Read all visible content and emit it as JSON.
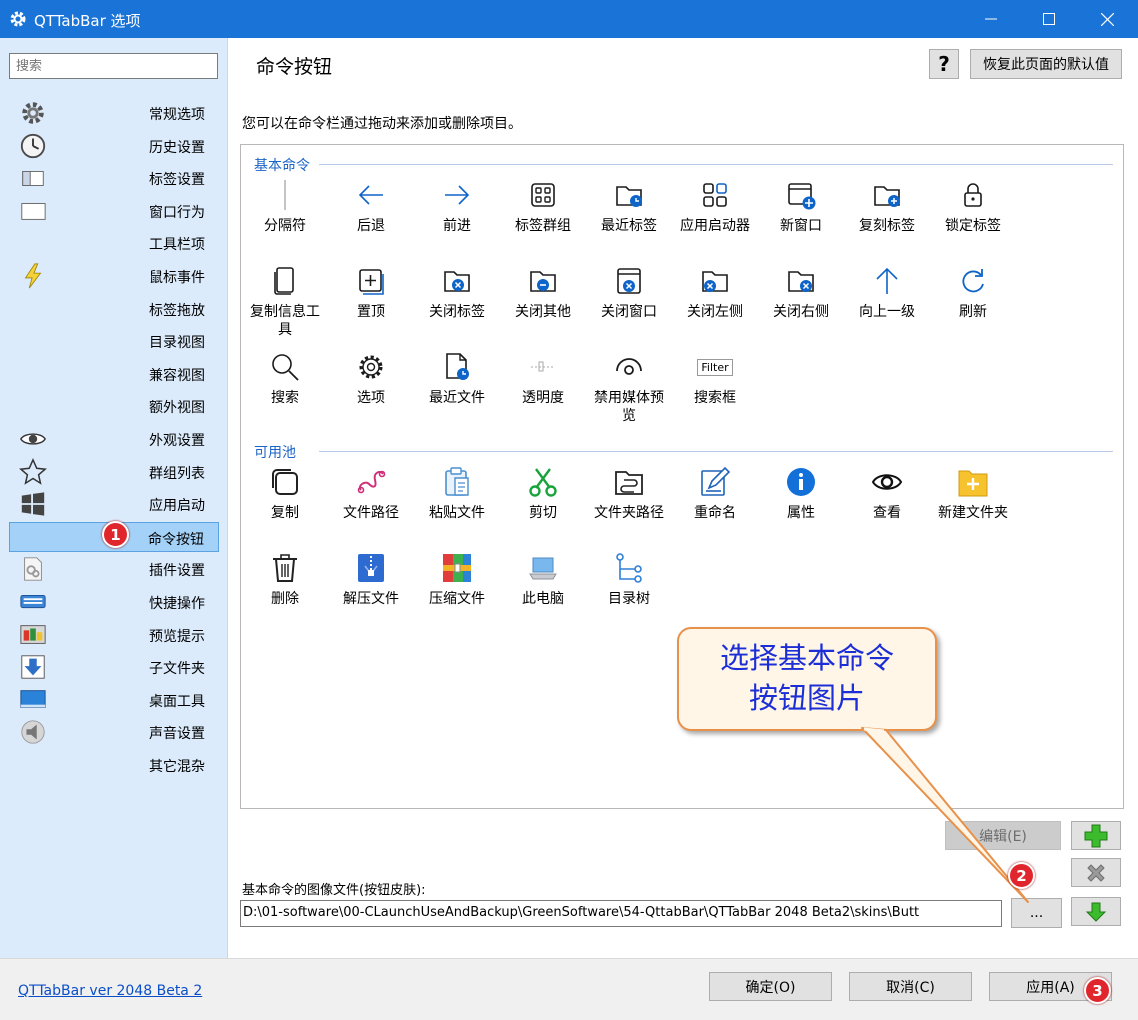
{
  "window": {
    "title": "QTTabBar 选项"
  },
  "sidebar": {
    "search_placeholder": "搜索",
    "items": [
      {
        "label": "常规选项",
        "icon": "gear-icon"
      },
      {
        "label": "历史设置",
        "icon": "clock-icon"
      },
      {
        "label": "标签设置",
        "icon": "tabs-icon"
      },
      {
        "label": "窗口行为",
        "icon": "window-icon"
      },
      {
        "label": "工具栏项",
        "icon": ""
      },
      {
        "label": "鼠标事件",
        "icon": "lightning-icon"
      },
      {
        "label": "标签拖放",
        "icon": ""
      },
      {
        "label": "目录视图",
        "icon": ""
      },
      {
        "label": "兼容视图",
        "icon": ""
      },
      {
        "label": "额外视图",
        "icon": ""
      },
      {
        "label": "外观设置",
        "icon": "eye-icon"
      },
      {
        "label": "群组列表",
        "icon": "star-icon"
      },
      {
        "label": "应用启动",
        "icon": "windows-logo-icon"
      },
      {
        "label": "命令按钮",
        "icon": "",
        "selected": true
      },
      {
        "label": "插件设置",
        "icon": "plugin-icon"
      },
      {
        "label": "快捷操作",
        "icon": "keyboard-icon"
      },
      {
        "label": "预览提示",
        "icon": "preview-icon"
      },
      {
        "label": "子文件夹",
        "icon": "download-arrow-icon"
      },
      {
        "label": "桌面工具",
        "icon": "desktop-icon"
      },
      {
        "label": "声音设置",
        "icon": "speaker-icon"
      },
      {
        "label": "其它混杂",
        "icon": ""
      }
    ]
  },
  "main": {
    "title": "命令按钮",
    "help_label": "?",
    "reset_label": "恢复此页面的默认值",
    "description": "您可以在命令栏通过拖动来添加或删除项目。",
    "basic_group_label": "基本命令",
    "pool_group_label": "可用池",
    "basic_commands": [
      {
        "label": "分隔符",
        "icon": "separator-icon"
      },
      {
        "label": "后退",
        "icon": "back-arrow-icon"
      },
      {
        "label": "前进",
        "icon": "forward-arrow-icon"
      },
      {
        "label": "标签群组",
        "icon": "tab-group-icon"
      },
      {
        "label": "最近标签",
        "icon": "recent-tabs-icon"
      },
      {
        "label": "应用启动器",
        "icon": "app-launcher-icon"
      },
      {
        "label": "新窗口",
        "icon": "new-window-icon"
      },
      {
        "label": "复刻标签",
        "icon": "clone-tab-icon"
      },
      {
        "label": "锁定标签",
        "icon": "lock-icon"
      },
      {
        "label": "复制信息工具",
        "icon": "copy-info-icon"
      },
      {
        "label": "置顶",
        "icon": "pin-top-icon"
      },
      {
        "label": "关闭标签",
        "icon": "close-tab-icon"
      },
      {
        "label": "关闭其他",
        "icon": "close-others-icon"
      },
      {
        "label": "关闭窗口",
        "icon": "close-window-icon"
      },
      {
        "label": "关闭左侧",
        "icon": "close-left-icon"
      },
      {
        "label": "关闭右侧",
        "icon": "close-right-icon"
      },
      {
        "label": "向上一级",
        "icon": "up-arrow-icon"
      },
      {
        "label": "刷新",
        "icon": "refresh-icon"
      },
      {
        "label": "搜索",
        "icon": "search-icon"
      },
      {
        "label": "选项",
        "icon": "options-gear-icon"
      },
      {
        "label": "最近文件",
        "icon": "recent-files-icon"
      },
      {
        "label": "透明度",
        "icon": "transparency-icon"
      },
      {
        "label": "禁用媒体预览",
        "icon": "disable-preview-icon"
      },
      {
        "label": "搜索框",
        "icon": "filter-box-icon",
        "icon_text": "Filter"
      }
    ],
    "pool_commands": [
      {
        "label": "复制",
        "icon": "copy-icon"
      },
      {
        "label": "文件路径",
        "icon": "file-path-icon"
      },
      {
        "label": "粘贴文件",
        "icon": "paste-icon"
      },
      {
        "label": "剪切",
        "icon": "scissors-icon"
      },
      {
        "label": "文件夹路径",
        "icon": "folder-path-icon"
      },
      {
        "label": "重命名",
        "icon": "rename-icon"
      },
      {
        "label": "属性",
        "icon": "info-icon"
      },
      {
        "label": "查看",
        "icon": "view-eye-icon"
      },
      {
        "label": "新建文件夹",
        "icon": "new-folder-icon"
      },
      {
        "label": "删除",
        "icon": "trash-icon"
      },
      {
        "label": "解压文件",
        "icon": "unzip-icon"
      },
      {
        "label": "压缩文件",
        "icon": "compress-icon"
      },
      {
        "label": "此电脑",
        "icon": "this-pc-icon"
      },
      {
        "label": "目录树",
        "icon": "tree-icon"
      }
    ],
    "callout_text": "选择基本命令按钮图片",
    "edit_label": "编辑(E)",
    "skin_label": "基本命令的图像文件(按钮皮肤):",
    "skin_path": "D:\\01-software\\00-CLaunchUseAndBackup\\GreenSoftware\\54-QttabBar\\QTTabBar 2048 Beta2\\skins\\Butt",
    "browse_label": "..."
  },
  "footer": {
    "version_link": "QTTabBar ver 2048 Beta 2",
    "ok_label": "确定(O)",
    "cancel_label": "取消(C)",
    "apply_label": "应用(A)"
  },
  "badges": [
    "1",
    "2",
    "3"
  ]
}
